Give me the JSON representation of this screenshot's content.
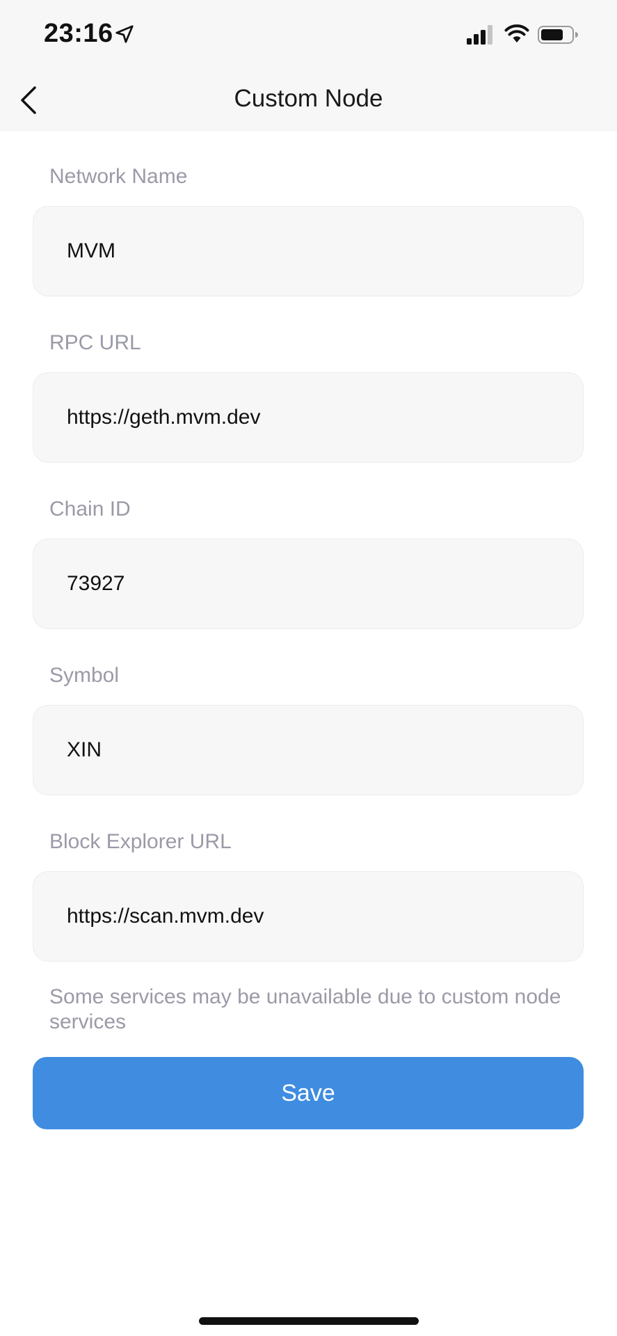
{
  "status_bar": {
    "time": "23:16",
    "icons": [
      "location-arrow-icon",
      "cellular-signal-icon",
      "wifi-icon",
      "battery-icon"
    ]
  },
  "header": {
    "title": "Custom Node",
    "back_icon": "chevron-left-icon"
  },
  "form": {
    "fields": [
      {
        "label": "Network Name",
        "value": "MVM"
      },
      {
        "label": "RPC URL",
        "value": "https://geth.mvm.dev"
      },
      {
        "label": "Chain ID",
        "value": "73927"
      },
      {
        "label": "Symbol",
        "value": "XIN"
      },
      {
        "label": "Block Explorer URL",
        "value": "https://scan.mvm.dev"
      }
    ],
    "notice": "Some services may be unavailable due to custom node services",
    "save_label": "Save"
  },
  "colors": {
    "accent": "#3f8ce0",
    "label": "#9a9aa8",
    "field_background": "#f7f7f7",
    "header_background": "#f7f7f7"
  }
}
